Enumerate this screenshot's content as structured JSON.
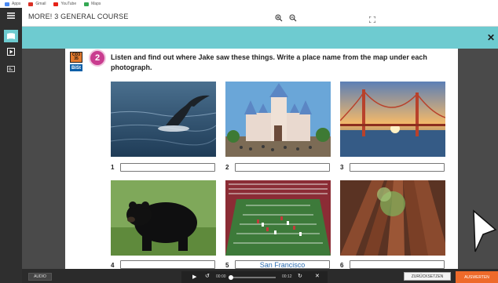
{
  "bookmarks": [
    {
      "label": "Apps",
      "color": "#4a8af4"
    },
    {
      "label": "Gmail",
      "color": "#d93025"
    },
    {
      "label": "YouTube",
      "color": "#e62117"
    },
    {
      "label": "Maps",
      "color": "#34a853"
    }
  ],
  "titlebar": {
    "title": "MORE! 3 GENERAL COURSE"
  },
  "exercise": {
    "cd_badge": {
      "line1": "CD3",
      "line2": "35"
    },
    "bist_badge": "BiSt",
    "number": "2",
    "instruction": "Listen and find out where Jake saw these things. Write a place name from the map under each photograph."
  },
  "answers": [
    {
      "number": "1",
      "value": ""
    },
    {
      "number": "2",
      "value": ""
    },
    {
      "number": "3",
      "value": ""
    },
    {
      "number": "4",
      "value": ""
    },
    {
      "number": "5",
      "value": "San Francisco"
    },
    {
      "number": "6",
      "value": ""
    }
  ],
  "photos": [
    "whale-tail-photo",
    "castle-photo",
    "golden-gate-bridge-photo",
    "black-bear-photo",
    "football-stadium-photo",
    "redwood-trees-photo"
  ],
  "bottombar": {
    "audio_label": "AUDIO",
    "time_current": "00:00",
    "time_total": "00:12",
    "progress": 0.05,
    "reset_label": "ZURÜCKSETZEN",
    "evaluate_label": "AUSWERTEN"
  },
  "colors": {
    "teal": "#6ecbd0",
    "accent": "#ee6a2a",
    "number_circle": "#c93c8f"
  }
}
